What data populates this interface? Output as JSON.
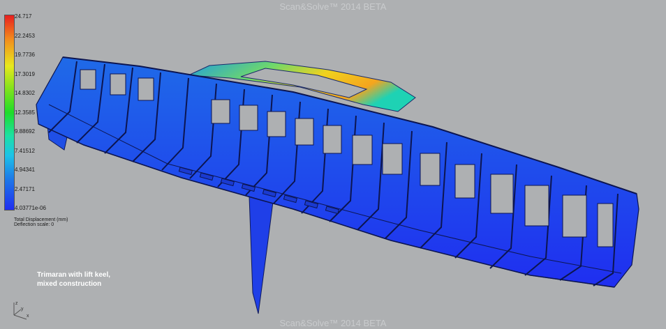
{
  "window": {
    "watermark_top": "Scan&Solve™ 2014 BETA",
    "watermark_bottom": "Scan&Solve™ 2014 BETA"
  },
  "legend": {
    "ticks": [
      "24.717",
      "22.2453",
      "19.7736",
      "17.3019",
      "14.8302",
      "12.3585",
      "9.88692",
      "7.41512",
      "4.94341",
      "2.47171",
      "4.03771e-06"
    ],
    "title": "Total Displacement (mm)",
    "scale": "Deflection scale: 0",
    "colors": [
      "#e81f1f",
      "#f28a1e",
      "#e8e81e",
      "#1edc2a",
      "#1ec3e8",
      "#1f2ef0"
    ]
  },
  "caption": {
    "line1": "Trimaran with lift keel,",
    "line2": "mixed construction"
  },
  "axes": {
    "x": "x",
    "y": "y",
    "z": "z"
  },
  "model": {
    "name": "trimaran-hull-model",
    "max_displacement_color": "#f5b21e",
    "min_displacement_color": "#1f2ef0"
  }
}
